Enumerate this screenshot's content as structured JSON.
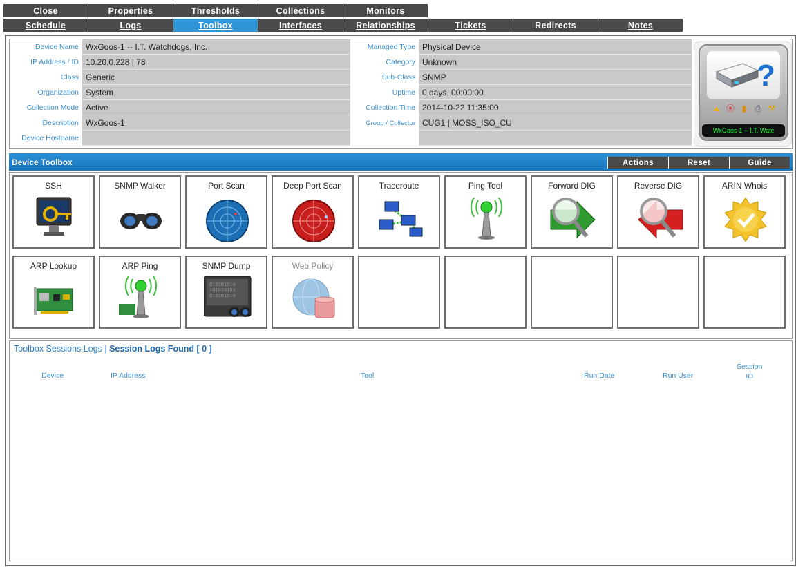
{
  "tabs_row1": [
    {
      "label": "Close",
      "active": false
    },
    {
      "label": "Properties",
      "active": false
    },
    {
      "label": "Thresholds",
      "active": false
    },
    {
      "label": "Collections",
      "active": false
    },
    {
      "label": "Monitors",
      "active": false
    }
  ],
  "tabs_row2": [
    {
      "label": "Schedule",
      "active": false
    },
    {
      "label": "Logs",
      "active": false
    },
    {
      "label": "Toolbox",
      "active": true
    },
    {
      "label": "Interfaces",
      "active": false
    },
    {
      "label": "Relationships",
      "active": false
    },
    {
      "label": "Tickets",
      "active": false
    },
    {
      "label": "Redirects",
      "active": false
    },
    {
      "label": "Notes",
      "active": false
    }
  ],
  "device": {
    "left": [
      {
        "label": "Device Name",
        "value": "WxGoos-1 -- I.T. Watchdogs, Inc."
      },
      {
        "label": "IP Address / ID",
        "value": "10.20.0.228 | 78"
      },
      {
        "label": "Class",
        "value": "Generic"
      },
      {
        "label": "Organization",
        "value": "System"
      },
      {
        "label": "Collection Mode",
        "value": "Active"
      },
      {
        "label": "Description",
        "value": "WxGoos-1"
      },
      {
        "label": "Device Hostname",
        "value": ""
      }
    ],
    "right": [
      {
        "label": "Managed Type",
        "value": "Physical Device"
      },
      {
        "label": "Category",
        "value": "Unknown"
      },
      {
        "label": "Sub-Class",
        "value": "SNMP"
      },
      {
        "label": "Uptime",
        "value": "0 days, 00:00:00"
      },
      {
        "label": "Collection Time",
        "value": "2014-10-22 11:35:00"
      },
      {
        "label": "Group / Collector",
        "value": "CUG1 | MOSS_ISO_CU"
      }
    ],
    "badge_name": "WxGoos-1 -- I.T. Watc"
  },
  "toolbox": {
    "title": "Device Toolbox",
    "actions_label": "Actions",
    "reset_label": "Reset",
    "guide_label": "Guide",
    "tools": [
      {
        "label": "SSH",
        "icon": "ssh-key-monitor-icon"
      },
      {
        "label": "SNMP Walker",
        "icon": "binoculars-icon"
      },
      {
        "label": "Port Scan",
        "icon": "radar-blue-icon"
      },
      {
        "label": "Deep Port Scan",
        "icon": "radar-red-icon"
      },
      {
        "label": "Traceroute",
        "icon": "network-computers-icon"
      },
      {
        "label": "Ping Tool",
        "icon": "antenna-icon"
      },
      {
        "label": "Forward DIG",
        "icon": "magnifier-arrow-right-icon"
      },
      {
        "label": "Reverse DIG",
        "icon": "magnifier-arrow-left-icon"
      },
      {
        "label": "ARIN Whois",
        "icon": "gold-seal-check-icon"
      },
      {
        "label": "ARP Lookup",
        "icon": "network-card-icon"
      },
      {
        "label": "ARP Ping",
        "icon": "antenna-card-icon"
      },
      {
        "label": "SNMP Dump",
        "icon": "binary-screen-binoculars-icon"
      },
      {
        "label": "Web Policy",
        "icon": "globe-database-icon"
      }
    ]
  },
  "logs": {
    "title": "Toolbox Sessions Logs",
    "found": "Session Logs Found [ 0 ]",
    "columns": {
      "device": "Device",
      "ip": "IP Address",
      "tool": "Tool",
      "run_date": "Run Date",
      "run_user": "Run User",
      "session_line1": "Session",
      "session_line2": "ID"
    }
  },
  "colors": {
    "accent": "#2e96d6",
    "tab": "#4a4a4a",
    "label": "#3a8fd0",
    "badge_text": "#19ff3a"
  }
}
